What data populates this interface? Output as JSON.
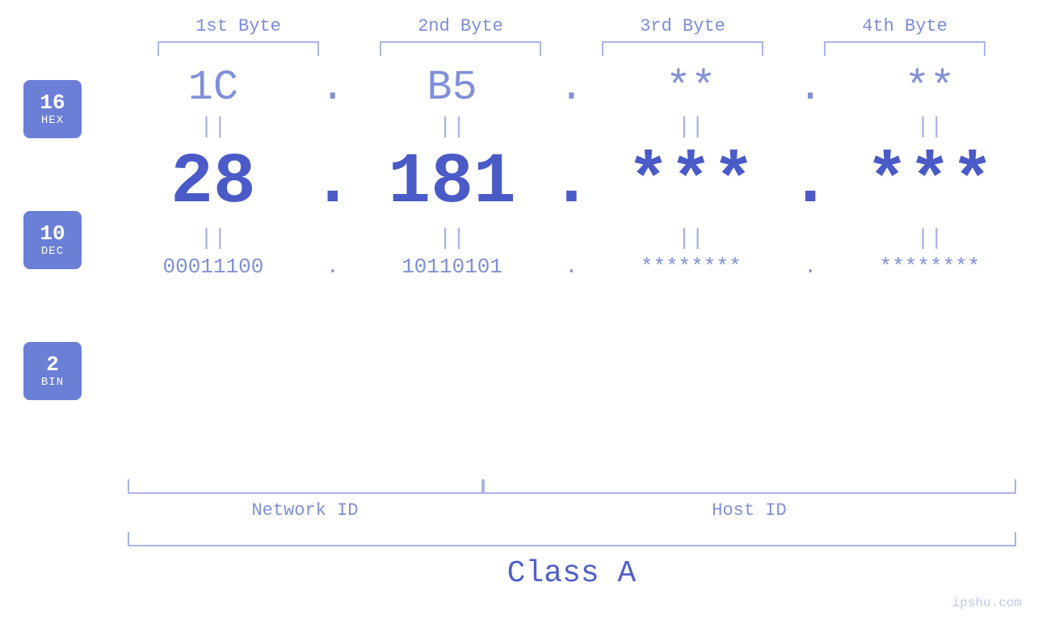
{
  "header": {
    "bytes": [
      "1st Byte",
      "2nd Byte",
      "3rd Byte",
      "4th Byte"
    ]
  },
  "badges": [
    {
      "number": "16",
      "label": "HEX"
    },
    {
      "number": "10",
      "label": "DEC"
    },
    {
      "number": "2",
      "label": "BIN"
    }
  ],
  "rows": {
    "hex": {
      "values": [
        "1C",
        "B5",
        "**",
        "**"
      ],
      "dots": [
        ".",
        ".",
        ".",
        ""
      ]
    },
    "equals": "||",
    "dec": {
      "values": [
        "28",
        "181",
        "***",
        "***"
      ],
      "dots": [
        ".",
        ".",
        ".",
        ""
      ]
    },
    "bin": {
      "values": [
        "00011100",
        "10110101",
        "********",
        "********"
      ],
      "dots": [
        ".",
        ".",
        ".",
        ""
      ]
    }
  },
  "labels": {
    "network_id": "Network ID",
    "host_id": "Host ID",
    "class": "Class A"
  },
  "watermark": "ipshu.com"
}
